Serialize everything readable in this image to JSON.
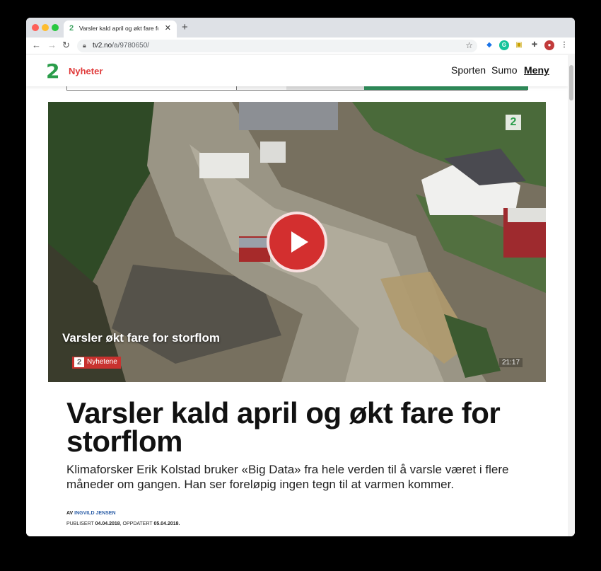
{
  "browser": {
    "tab_title": "Varsler kald april og økt fare fo",
    "tab_favicon": "2",
    "url_host": "tv2.no",
    "url_path": "/a/9780650/"
  },
  "site": {
    "logo_glyph": "2",
    "section": "Nyheter",
    "nav": {
      "sporten": "Sporten",
      "sumo": "Sumo",
      "meny": "Meny"
    }
  },
  "video": {
    "title": "Varsler økt fare for storflom",
    "channel_num": "2",
    "channel": "Nyhetene",
    "duration": "21:17",
    "corner_logo": "2"
  },
  "article": {
    "headline": "Varsler kald april og økt fare for storflom",
    "lead": "Klimaforsker Erik Kolstad bruker «Big Data» fra hele verden til å varsle været i flere måneder om gangen. Han ser foreløpig ingen tegn til at varmen kommer.",
    "byline_prefix": "AV",
    "author": "INGVILD JENSEN",
    "published_label": "PUBLISERT",
    "published_date": "04.04.2018",
    "updated_label": ", OPPDATERT",
    "updated_date": "05.04.2018."
  },
  "colors": {
    "brand_green": "#2a9d4a",
    "brand_red": "#e03a3a",
    "play_red": "#d32f2f"
  }
}
